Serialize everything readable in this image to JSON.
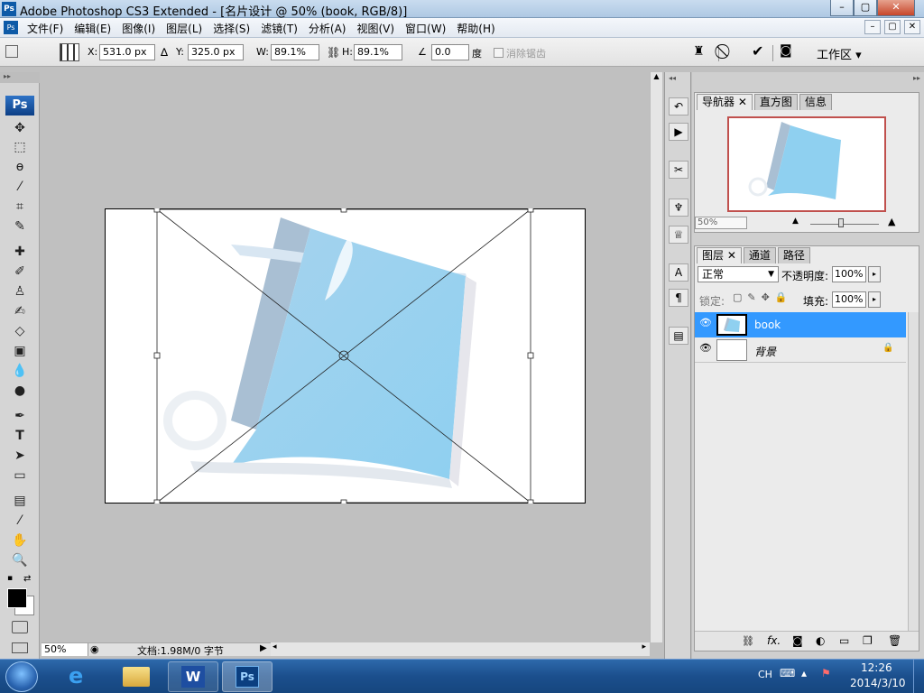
{
  "window": {
    "title": "Adobe Photoshop CS3 Extended - [名片设计 @ 50% (book, RGB/8)]",
    "app_icon": "Ps",
    "minimize": "–",
    "maximize": "▢",
    "close": "✕"
  },
  "menu": {
    "items": [
      "文件(F)",
      "编辑(E)",
      "图像(I)",
      "图层(L)",
      "选择(S)",
      "滤镜(T)",
      "分析(A)",
      "视图(V)",
      "窗口(W)",
      "帮助(H)"
    ],
    "mdi": [
      "–",
      "▢",
      "✕"
    ]
  },
  "options": {
    "x_label": "X:",
    "x_value": "531.0 px",
    "y_label": "Y:",
    "y_value": "325.0 px",
    "w_label": "W:",
    "w_value": "89.1%",
    "h_label": "H:",
    "h_value": "89.1%",
    "angle_value": "0.0",
    "angle_unit": "度",
    "antialias_label": "消除锯齿",
    "workspace_label": "工作区 ▾"
  },
  "toolbox": {
    "logo": "Ps"
  },
  "status": {
    "zoom": "50%",
    "doc_info": "文档:1.98M/0 字节"
  },
  "navigator": {
    "tabs": [
      "导航器",
      "直方图",
      "信息"
    ],
    "zoom": "50%"
  },
  "layers": {
    "tabs": [
      "图层",
      "通道",
      "路径"
    ],
    "blend_mode": "正常",
    "opacity_label": "不透明度:",
    "opacity_value": "100%",
    "lock_label": "锁定:",
    "fill_label": "填充:",
    "fill_value": "100%",
    "rows": [
      {
        "name": "book"
      },
      {
        "name": "背景"
      }
    ],
    "footer_fx": "fx."
  },
  "taskbar": {
    "lang": "CH",
    "time": "12:26",
    "date": "2014/3/10"
  },
  "colors": {
    "selection": "#3399ff",
    "canvas_bg": "#c0c0c0",
    "book_blue": "#8ec9ea",
    "spine_gray": "#a9bfd3"
  }
}
